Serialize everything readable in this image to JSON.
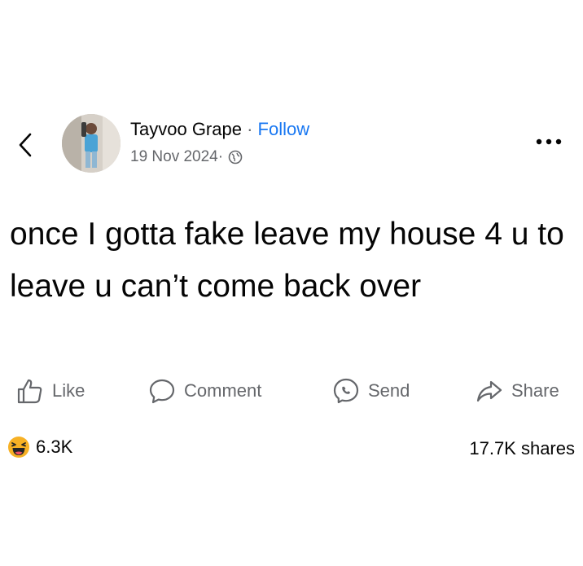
{
  "header": {
    "author_name": "Tayvoo Grape",
    "separator": " · ",
    "follow_label": "Follow",
    "date": "19 Nov 2024",
    "meta_separator": " ·",
    "visibility_icon": "globe-icon",
    "back_icon": "chevron-left-icon",
    "more_icon": "more-dots-icon"
  },
  "post": {
    "text": "once I gotta fake leave my house 4 u to leave u can’t come back over"
  },
  "actions": [
    {
      "label": "Like",
      "icon": "thumbs-up-icon"
    },
    {
      "label": "Comment",
      "icon": "comment-bubble-icon"
    },
    {
      "label": "Send",
      "icon": "messenger-icon"
    },
    {
      "label": "Share",
      "icon": "share-arrow-icon"
    }
  ],
  "stats": {
    "reaction_icon": "haha-reaction-icon",
    "reaction_count": "6.3K",
    "shares": "17.7K shares"
  },
  "colors": {
    "text": "#050505",
    "secondary": "#65676b",
    "follow": "#1877f2",
    "reaction": "#f7b125"
  }
}
